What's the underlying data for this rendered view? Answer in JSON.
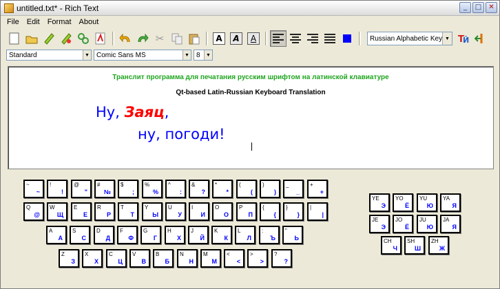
{
  "window": {
    "title": "untitled.txt* - Rich Text",
    "btn_minimize": "_",
    "btn_maximize": "□",
    "btn_close": "✕"
  },
  "menu": [
    {
      "label": "File",
      "name": "menu-file"
    },
    {
      "label": "Edit",
      "name": "menu-edit"
    },
    {
      "label": "Format",
      "name": "menu-format"
    },
    {
      "label": "About",
      "name": "menu-about"
    }
  ],
  "toolbar": {
    "icons": [
      "new-icon",
      "open-icon",
      "save-icon",
      "save-as-icon",
      "print-icon",
      "pdf-icon",
      "undo-icon",
      "redo-icon",
      "cut-icon",
      "copy-icon",
      "paste-icon",
      "bold-icon",
      "italic-icon",
      "underline-icon",
      "align-left-icon",
      "align-center-icon",
      "align-right-icon",
      "justify-icon",
      "color-icon",
      "keyboard-layout-icon",
      "exit-icon"
    ],
    "bold_label": "A",
    "italic_label": "A",
    "underline_label": "A",
    "layout_select": "Russian Alphabetic Keyboard"
  },
  "format": {
    "style_select": "Standard",
    "font_select": "Comic Sans MS",
    "size_select": "8"
  },
  "colors": {
    "accent": "#0000ff",
    "green": "#1fa51f",
    "red": "#ff0000"
  },
  "editor": {
    "line1": "Транслит программа для печатания русским шрифтом на латинской клавиатуре",
    "line2": "Qt-based Latin-Russian Keyboard Translation",
    "line3_a": "Ну, ",
    "line3_b": "Заяц",
    ",line3_c": ",",
    "line4": "ну, погоди!"
  },
  "keyboard": {
    "rows": [
      [
        [
          "~",
          "~"
        ],
        [
          "!",
          "!"
        ],
        [
          "@",
          "\""
        ],
        [
          "#",
          "№"
        ],
        [
          "$",
          ";"
        ],
        [
          "%",
          "%"
        ],
        [
          "^",
          ":"
        ],
        [
          "&",
          "?"
        ],
        [
          "*",
          "*"
        ],
        [
          "(",
          "("
        ],
        [
          ")",
          ")"
        ],
        [
          "_",
          "_"
        ],
        [
          "+",
          "+"
        ]
      ],
      [
        [
          "Q",
          "@"
        ],
        [
          "W",
          "Щ"
        ],
        [
          "E",
          "Е"
        ],
        [
          "R",
          "Р"
        ],
        [
          "T",
          "Т"
        ],
        [
          "Y",
          "Ы"
        ],
        [
          "U",
          "У"
        ],
        [
          "I",
          "И"
        ],
        [
          "O",
          "О"
        ],
        [
          "P",
          "П"
        ],
        [
          "{",
          "{"
        ],
        [
          "}",
          "}"
        ],
        [
          "|",
          "|"
        ]
      ],
      [
        [
          "A",
          "А"
        ],
        [
          "S",
          "С"
        ],
        [
          "D",
          "Д"
        ],
        [
          "F",
          "Ф"
        ],
        [
          "G",
          "Г"
        ],
        [
          "H",
          "Х"
        ],
        [
          "J",
          "Й"
        ],
        [
          "K",
          "К"
        ],
        [
          "L",
          "Л"
        ],
        [
          ":",
          "Ъ"
        ],
        [
          "\"",
          "Ь"
        ]
      ],
      [
        [
          "Z",
          "З"
        ],
        [
          "X",
          "Х"
        ],
        [
          "C",
          "Ц"
        ],
        [
          "V",
          "В"
        ],
        [
          "B",
          "Б"
        ],
        [
          "N",
          "Н"
        ],
        [
          "M",
          "М"
        ],
        [
          "<",
          "<"
        ],
        [
          ">",
          ">"
        ],
        [
          "?",
          "?"
        ]
      ]
    ],
    "extra": [
      [
        [
          "YE",
          "Э"
        ],
        [
          "YO",
          "Ё"
        ],
        [
          "YU",
          "Ю"
        ],
        [
          "YA",
          "Я"
        ]
      ],
      [
        [
          "JE",
          "Э"
        ],
        [
          "JO",
          "Ё"
        ],
        [
          "JU",
          "Ю"
        ],
        [
          "JA",
          "Я"
        ]
      ],
      [
        [
          "CH",
          "Ч"
        ],
        [
          "SH",
          "Ш"
        ],
        [
          "ZH",
          "Ж"
        ]
      ]
    ]
  }
}
